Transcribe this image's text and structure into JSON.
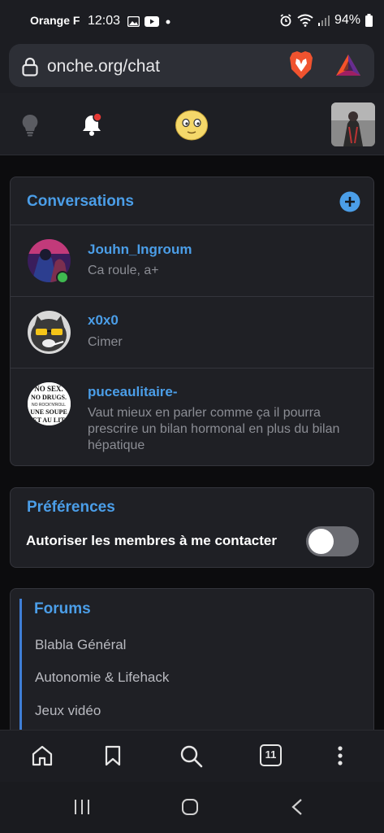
{
  "status_bar": {
    "carrier": "Orange F",
    "time": "12:03",
    "battery": "94%"
  },
  "browser": {
    "url": "onche.org/chat",
    "tab_count": "11"
  },
  "colors": {
    "accent": "#4b9ee8",
    "online": "#3fb950",
    "notification": "#e53935",
    "card_bg": "#1f2025"
  },
  "icons": [
    "lock-icon",
    "brave-lion-icon",
    "bat-triangle-icon",
    "lightbulb-icon",
    "bell-icon",
    "smiley-icon",
    "plus-circle-icon",
    "home-icon",
    "bookmark-icon",
    "search-icon",
    "more-vertical-icon",
    "recent-apps-icon",
    "home-circle-icon",
    "back-icon"
  ],
  "conversations": {
    "title": "Conversations",
    "items": [
      {
        "name": "Jouhn_Ingroum",
        "message": "Ca roule, a+",
        "online": true
      },
      {
        "name": "x0x0",
        "message": "Cimer",
        "online": false
      },
      {
        "name": "puceaulitaire-",
        "message": "Vaut mieux en parler comme ça il pourra prescrire un bilan hormonal en plus du bilan hépatique",
        "online": false,
        "avatar_text": [
          "NO SEX.",
          "NO DRUGS.",
          "NO ROCK'N'ROLL",
          "UNE SOUPE",
          "ET AU LIT"
        ]
      }
    ]
  },
  "preferences": {
    "title": "Préférences",
    "allow_contact_label": "Autoriser les membres à me contacter",
    "allow_contact_enabled": false
  },
  "forums": {
    "title": "Forums",
    "links": [
      "Blabla Général",
      "Autonomie & Lifehack",
      "Jeux vidéo"
    ]
  }
}
